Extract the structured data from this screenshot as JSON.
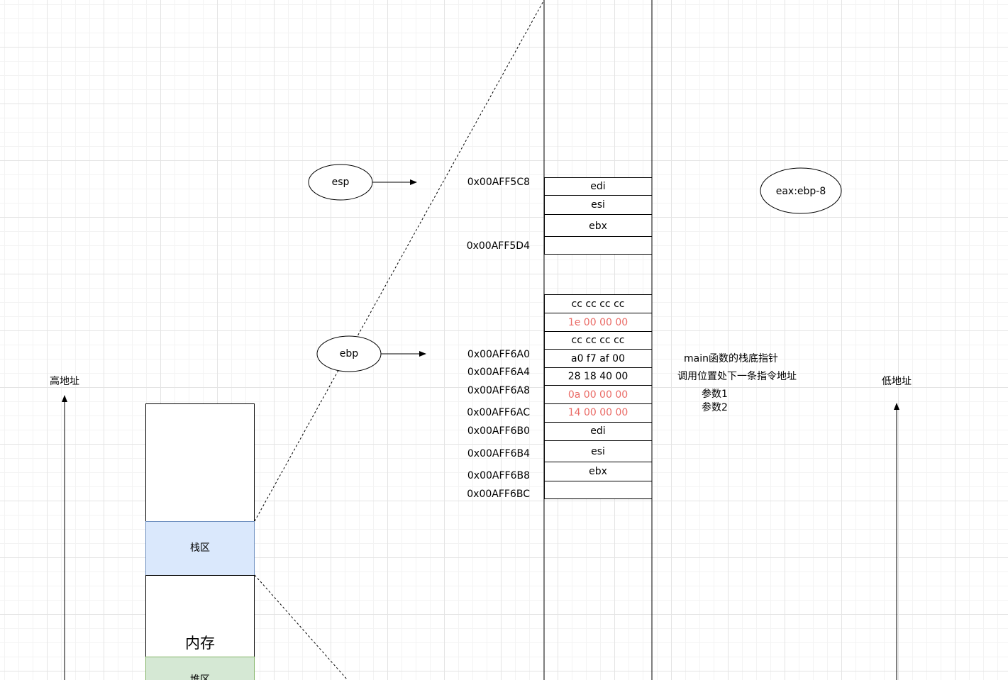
{
  "axes": {
    "high_label": "高地址",
    "low_label": "低地址"
  },
  "memory": {
    "title": "内存",
    "stack_label": "栈区",
    "heap_label": "堆区",
    "stack_color": "#dae8fc",
    "stack_border": "#6c8ebf",
    "heap_color": "#d5e8d4",
    "heap_border": "#82b366"
  },
  "registers": {
    "esp": "esp",
    "ebp": "ebp",
    "eax_note": "eax:ebp-8"
  },
  "stack": {
    "cells": [
      {
        "text": "edi",
        "color": "#000000"
      },
      {
        "text": "esi",
        "color": "#000000"
      },
      {
        "text": "ebx",
        "color": "#000000"
      },
      {
        "text": "",
        "color": "#000000"
      },
      {
        "text": "cc cc cc cc",
        "color": "#000000"
      },
      {
        "text": "1e 00 00 00",
        "color": "#ea6b66"
      },
      {
        "text": "cc cc cc cc",
        "color": "#000000"
      },
      {
        "text": "a0 f7 af 00",
        "color": "#000000"
      },
      {
        "text": "28 18 40 00",
        "color": "#000000"
      },
      {
        "text": "0a 00 00 00",
        "color": "#ea6b66"
      },
      {
        "text": "14 00 00 00",
        "color": "#ea6b66"
      },
      {
        "text": "edi",
        "color": "#000000"
      },
      {
        "text": "esi",
        "color": "#000000"
      },
      {
        "text": "ebx",
        "color": "#000000"
      },
      {
        "text": "",
        "color": "#000000"
      }
    ],
    "addresses": [
      "0x00AFF5C8",
      "0x00AFF5D4",
      "0x00AFF6A0",
      "0x00AFF6A4",
      "0x00AFF6A8",
      "0x00AFF6AC",
      "0x00AFF6B0",
      "0x00AFF6B4",
      "0x00AFF6B8",
      "0x00AFF6BC"
    ]
  },
  "notes": {
    "main_ebp": "main函数的栈底指针",
    "return_addr": "调用位置处下一条指令地址",
    "param1": "参数1",
    "param2": "参数2"
  }
}
